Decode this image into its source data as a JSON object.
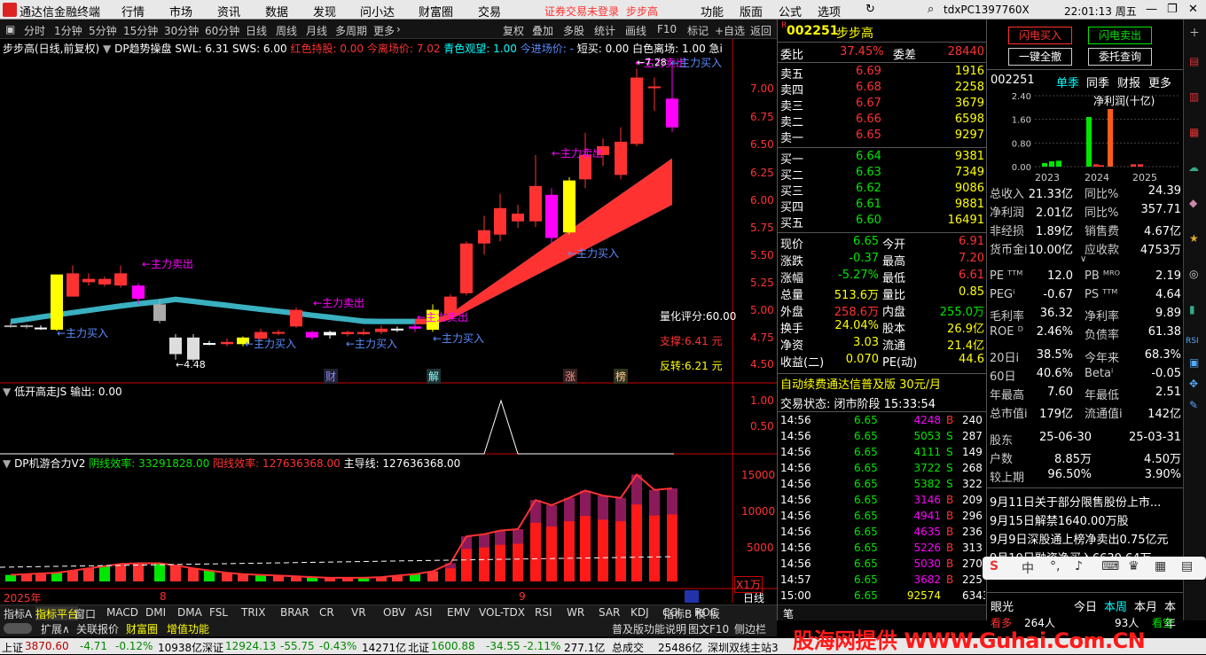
{
  "titlebar": {
    "app": "通达信金融终端",
    "menus": [
      "行情",
      "市场",
      "资讯",
      "数据",
      "发现",
      "问小达",
      "财富圈",
      "交易"
    ],
    "login_status": "证券交易未登录",
    "stock_name": "步步高",
    "right_menus": [
      "功能",
      "版面",
      "公式",
      "选项"
    ],
    "machine": "tdxPC1397760X",
    "time": "22:01:13 周五"
  },
  "toolbar": {
    "periods": [
      "分时",
      "1分钟",
      "5分钟",
      "15分钟",
      "30分钟",
      "60分钟",
      "日线",
      "周线",
      "月线",
      "多周期",
      "更多"
    ],
    "actions": [
      "复权",
      "叠加",
      "多股",
      "统计",
      "画线",
      "F10",
      "标记",
      "+自选",
      "返回"
    ]
  },
  "chart": {
    "header": {
      "title": "步步高(日线,前复权)",
      "indicator": "DP趋势操盘",
      "swl": "SWL: 6.31",
      "sws": "SWS: 6.00",
      "hold": "红色持股: 0.00",
      "leave": "今离场价: 7.02",
      "watch": "青色观望: 1.00",
      "enter": "今进场价: -",
      "short": "短买: 0.00",
      "white": "白色离场: 1.00",
      "rush": "急i"
    },
    "y_ticks": [
      "7.00",
      "6.75",
      "6.50",
      "6.25",
      "6.00",
      "5.75",
      "5.50",
      "5.25",
      "5.00",
      "4.75",
      "4.50"
    ],
    "signals": [
      "←主力卖出",
      "←主力卖出",
      "←主力卖出",
      "←主力卖出",
      "←主力卖出",
      "←主力买入",
      "←主力买入",
      "←主力买入",
      "←主力买入",
      "←主力买入",
      "←主力买入"
    ],
    "high_label": "7.28",
    "low_label": "4.48",
    "score": "量化评分:60.00",
    "support": "支撑:6.41 元",
    "reversal": "反转:6.21 元",
    "markers": [
      "财",
      "解",
      "涨",
      "榜"
    ],
    "ind1": {
      "title": "低开高走JS",
      "output": "输出: 0.00",
      "y_ticks": [
        "1.00",
        "0.50"
      ]
    },
    "ind2": {
      "title": "DP机游合力V2",
      "yin": "阴线效率: 33291828.00",
      "yang": "阳线效率: 127636368.00",
      "main": "主导线: 127636368.00",
      "y_ticks": [
        "15000",
        "10000",
        "5000"
      ],
      "unit": "X1万"
    },
    "xaxis": {
      "year": "2025年",
      "m1": "8",
      "m2": "9",
      "right": "日线"
    }
  },
  "bottomtabs": [
    "指标A",
    "指标平台",
    "窗口",
    "MACD",
    "DMI",
    "DMA",
    "FSL",
    "TRIX",
    "BRAR",
    "CR",
    "VR",
    "OBV",
    "ASI",
    "EMV",
    "VOL-TDX",
    "RSI",
    "WR",
    "SAR",
    "KDJ",
    "CCI",
    "ROC",
    "指标B",
    "模 板"
  ],
  "bottomtabs2": [
    "扩展∧",
    "关联报价",
    "财富圈",
    "增值功能",
    "普及版功能说明",
    "图文F10",
    "侧边栏"
  ],
  "quote": {
    "code": "002251",
    "name": "步步高",
    "wb_label": "委比",
    "wb": "37.45%",
    "wc_label": "委差",
    "wc": "28440",
    "sell": [
      [
        "卖五",
        "6.69",
        "1916"
      ],
      [
        "卖四",
        "6.68",
        "2258"
      ],
      [
        "卖三",
        "6.67",
        "3679"
      ],
      [
        "卖二",
        "6.66",
        "6598"
      ],
      [
        "卖一",
        "6.65",
        "9297"
      ]
    ],
    "buy": [
      [
        "买一",
        "6.64",
        "9381"
      ],
      [
        "买二",
        "6.63",
        "7349"
      ],
      [
        "买三",
        "6.62",
        "9086"
      ],
      [
        "买四",
        "6.61",
        "9881"
      ],
      [
        "买五",
        "6.60",
        "16491"
      ]
    ],
    "stats": [
      [
        "现价",
        "6.65",
        "今开",
        "6.91"
      ],
      [
        "涨跌",
        "-0.37",
        "最高",
        "7.20"
      ],
      [
        "涨幅",
        "-5.27%",
        "最低",
        "6.61"
      ],
      [
        "总量",
        "513.6万",
        "量比",
        "0.85"
      ],
      [
        "外盘",
        "258.6万",
        "内盘",
        "255.0万"
      ],
      [
        "换手",
        "24.04%",
        "股本",
        "26.9亿"
      ],
      [
        "净资",
        "3.03",
        "流通",
        "21.4亿"
      ],
      [
        "收益(二)",
        "0.070",
        "PE(动)",
        "44.6"
      ]
    ],
    "ad": "自动续费通达信普及版 30元/月",
    "trade_status": "交易状态: 闭市阶段 15:33:54",
    "ticks": [
      [
        "14:56",
        "6.65",
        "4248",
        "B",
        "240"
      ],
      [
        "14:56",
        "6.65",
        "5053",
        "S",
        "287"
      ],
      [
        "14:56",
        "6.65",
        "4111",
        "S",
        "149"
      ],
      [
        "14:56",
        "6.65",
        "3722",
        "S",
        "268"
      ],
      [
        "14:56",
        "6.65",
        "5382",
        "S",
        "322"
      ],
      [
        "14:56",
        "6.65",
        "3146",
        "B",
        "209"
      ],
      [
        "14:56",
        "6.65",
        "4941",
        "B",
        "296"
      ],
      [
        "14:56",
        "6.65",
        "4635",
        "B",
        "236"
      ],
      [
        "14:56",
        "6.65",
        "5226",
        "B",
        "313"
      ],
      [
        "14:56",
        "6.65",
        "5030",
        "B",
        "270"
      ],
      [
        "14:57",
        "6.65",
        "3682",
        "B",
        "225"
      ],
      [
        "15:00",
        "6.65",
        "92574",
        "",
        "6343"
      ]
    ]
  },
  "far": {
    "btn_flash_buy": "闪电买入",
    "btn_flash_sell": "闪电卖出",
    "btn_clear": "一键全撤",
    "btn_query": "委托查询",
    "code": "002251",
    "tabs": [
      "单季",
      "同季",
      "财报",
      "更多"
    ],
    "chart_title": "净利润(十亿)",
    "fin_chart": {
      "type": "bar",
      "categories": [
        "2023",
        "2024",
        "2025"
      ],
      "y_ticks": [
        "2.40",
        "1.60",
        "0.80",
        "0.00"
      ],
      "ylim": [
        0,
        2.4
      ],
      "values": [
        0.12,
        0.18,
        0.2,
        1.68,
        0.08,
        0.05,
        1.95,
        0.08,
        0.08
      ],
      "colors": [
        "#00e600",
        "#00e600",
        "#00e600",
        "#00e600",
        "#ff3232",
        "#ff3232",
        "#ff5a1e",
        "#ff3232",
        "#ff3232"
      ]
    },
    "fin": [
      [
        "总收入",
        "21.33亿",
        "同比%",
        "24.39"
      ],
      [
        "净利润",
        "2.01亿",
        "同比%",
        "357.71"
      ],
      [
        "非经损",
        "1.89亿",
        "销售费",
        "4.67亿"
      ],
      [
        "货币金i",
        "10.00亿",
        "应收款",
        "4753万"
      ]
    ],
    "val": [
      [
        "PE ᵀᵀᴹ",
        "12.0",
        "PB ᴹᴿᴼ",
        "2.19"
      ],
      [
        "PEGⁱ",
        "-0.67",
        "PS ᵀᵀᴹ",
        "4.64"
      ],
      [
        "毛利率",
        "36.32",
        "净利率",
        "9.89"
      ],
      [
        "ROE ᴰ",
        "2.46%",
        "负债率",
        "61.38"
      ]
    ],
    "perf": [
      [
        "20日i",
        "38.5%",
        "今年来",
        "68.3%"
      ],
      [
        "60日",
        "40.6%",
        "Betaⁱ",
        "-0.05"
      ],
      [
        "年最高",
        "7.60",
        "年最低",
        "2.51"
      ],
      [
        "总市值i",
        "179亿",
        "流通值i",
        "142亿"
      ]
    ],
    "holder": [
      [
        "股东",
        "25-06-30",
        "25-03-31"
      ],
      [
        "户数",
        "8.85万",
        "4.50万"
      ],
      [
        "较上期",
        "96.50%",
        "3.90%"
      ]
    ],
    "news": [
      "9月11日关于部分限售股份上市...",
      "9月15日解禁1640.00万股",
      "9月9日深股通上榜净卖出0.75亿元",
      "9月10日融资净买入6630.64万..."
    ],
    "eyes_label": "眼光",
    "eyes_tabs": [
      "今日",
      "本周",
      "本月",
      "本年"
    ],
    "watch1": "看多",
    "watch1_val": "264人",
    "watch2_val": "93人",
    "watch2": "看空"
  },
  "status": {
    "sh_label": "上证",
    "sh": "3870.60",
    "sh_chg": "-4.71",
    "sh_pct": "-0.12%",
    "sh_amt": "10938亿",
    "sz_label": "深证",
    "sz": "12924.13",
    "sz_chg": "-55.75",
    "sz_pct": "-0.43%",
    "sz_amt": "14271亿",
    "bz_label": "北证",
    "bz": "1600.88",
    "bz_chg": "-34.55",
    "bz_pct": "-2.11%",
    "bz_amt": "277.1亿",
    "total_label": "总成交",
    "total": "25486亿",
    "server": "深圳双线主站3"
  },
  "watermark": "股海网提供 WWW.Guhai.Com.CN"
}
